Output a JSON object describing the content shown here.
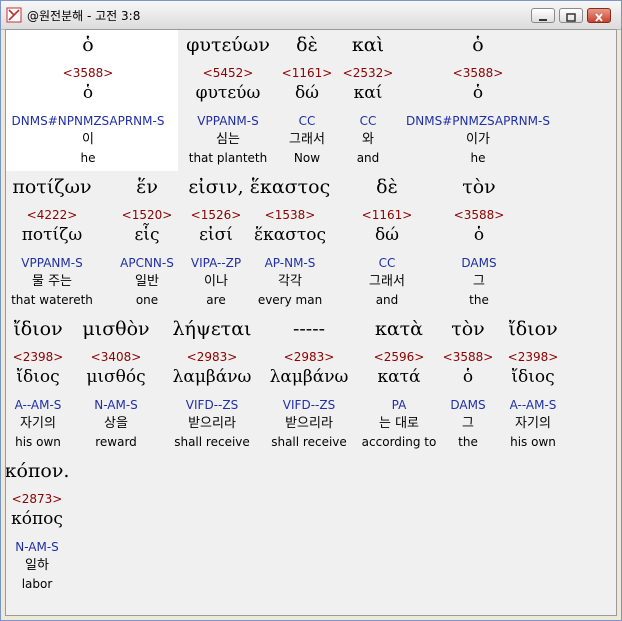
{
  "window": {
    "title": "@원전분해 - 고전 3:8"
  },
  "lines": [
    {
      "words": [
        {
          "greek": "ὁ",
          "strong": "<3588>",
          "lexeme": "ὁ",
          "parse": "DNMS#NPNMZSAPRNM-S",
          "korean": "이",
          "english": "he",
          "highlight": true
        },
        {
          "greek": "φυτεύων",
          "strong": "<5452>",
          "lexeme": "φυτεύω",
          "parse": "VPPANM-S",
          "korean": "심는",
          "english": "that planteth"
        },
        {
          "greek": "δὲ",
          "strong": "<1161>",
          "lexeme": "δώ",
          "parse": "CC",
          "korean": "그래서",
          "english": "Now"
        },
        {
          "greek": "καὶ",
          "strong": "<2532>",
          "lexeme": "καί",
          "parse": "CC",
          "korean": "와",
          "english": "and"
        },
        {
          "greek": "ὁ",
          "strong": "<3588>",
          "lexeme": "ὁ",
          "parse": "DNMS#PNMZSAPRNM-S",
          "korean": "이가",
          "english": "he"
        }
      ]
    },
    {
      "words": [
        {
          "greek": "ποτίζων",
          "strong": "<4222>",
          "lexeme": "ποτίζω",
          "parse": "VPPANM-S",
          "korean": "물 주는",
          "english": "that watereth"
        },
        {
          "greek": "ἕν",
          "strong": "<1520>",
          "lexeme": "εἷς",
          "parse": "APCNN-S",
          "korean": "일반",
          "english": "one"
        },
        {
          "greek": "εἰσιν,",
          "strong": "<1526>",
          "lexeme": "εἰσί",
          "parse": "VIPA--ZP",
          "korean": "이나",
          "english": "are"
        },
        {
          "greek": "ἕκαστος",
          "strong": "<1538>",
          "lexeme": "ἕκαστος",
          "parse": "AP-NM-S",
          "korean": "각각",
          "english": "every man"
        },
        {
          "greek": "δὲ",
          "strong": "<1161>",
          "lexeme": "δώ",
          "parse": "CC",
          "korean": "그래서",
          "english": "and"
        },
        {
          "greek": "τὸν",
          "strong": "<3588>",
          "lexeme": "ὁ",
          "parse": "DAMS",
          "korean": "그",
          "english": "the"
        }
      ]
    },
    {
      "words": [
        {
          "greek": "ἴδιον",
          "strong": "<2398>",
          "lexeme": "ἴδιος",
          "parse": "A--AM-S",
          "korean": "자기의",
          "english": "his own"
        },
        {
          "greek": "μισθὸν",
          "strong": "<3408>",
          "lexeme": "μισθός",
          "parse": "N-AM-S",
          "korean": "상을",
          "english": "reward"
        },
        {
          "greek": "λήψεται",
          "strong": "<2983>",
          "lexeme": "λαμβάνω",
          "parse": "VIFD--ZS",
          "korean": "받으리라",
          "english": "shall receive"
        },
        {
          "greek": "-----",
          "strong": "<2983>",
          "lexeme": "λαμβάνω",
          "parse": "VIFD--ZS",
          "korean": "받으리라",
          "english": "shall receive"
        },
        {
          "greek": "κατὰ",
          "strong": "<2596>",
          "lexeme": "κατά",
          "parse": "PA",
          "korean": "는 대로",
          "english": "according to"
        },
        {
          "greek": "τὸν",
          "strong": "<3588>",
          "lexeme": "ὁ",
          "parse": "DAMS",
          "korean": "그",
          "english": "the"
        },
        {
          "greek": "ἴδιον",
          "strong": "<2398>",
          "lexeme": "ἴδιος",
          "parse": "A--AM-S",
          "korean": "자기의",
          "english": "his own"
        }
      ]
    },
    {
      "words": [
        {
          "greek": "κόπον.",
          "strong": "<2873>",
          "lexeme": "κόπος",
          "parse": "N-AM-S",
          "korean": "일하",
          "english": "labor"
        }
      ]
    }
  ]
}
